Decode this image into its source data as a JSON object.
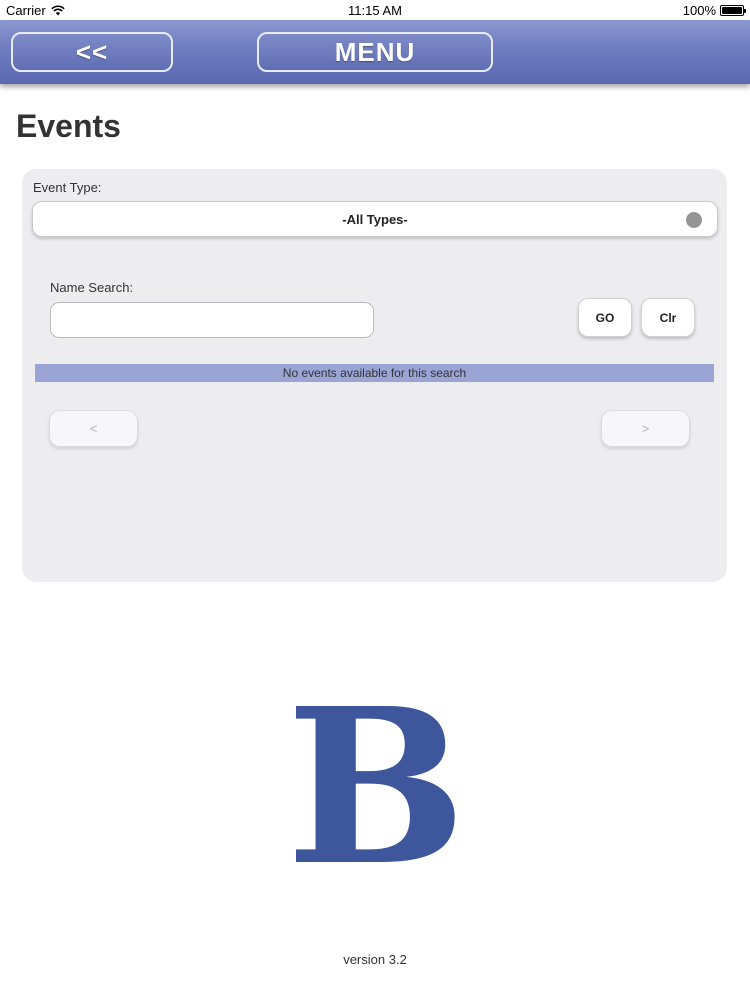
{
  "status_bar": {
    "carrier": "Carrier",
    "time": "11:15 AM",
    "battery": "100%",
    "wifi_icon": "wifi-icon",
    "battery_icon": "battery-icon"
  },
  "nav": {
    "back_label": "<<",
    "menu_label": "MENU"
  },
  "page": {
    "title": "Events"
  },
  "filters": {
    "event_type_label": "Event Type:",
    "event_type_value": "-All Types-",
    "name_search_label": "Name Search:",
    "name_search_value": "",
    "name_search_placeholder": "",
    "go_label": "GO",
    "clear_label": "Clr"
  },
  "results": {
    "message": "No events available for this search"
  },
  "pager": {
    "prev_label": "<",
    "next_label": ">"
  },
  "logo": {
    "letter": "B",
    "color": "#3d569c"
  },
  "footer": {
    "version": "version 3.2"
  },
  "colors": {
    "nav_bar": "#6e7cc0",
    "result_bar": "#9aa5d6",
    "panel": "#ededf0"
  }
}
